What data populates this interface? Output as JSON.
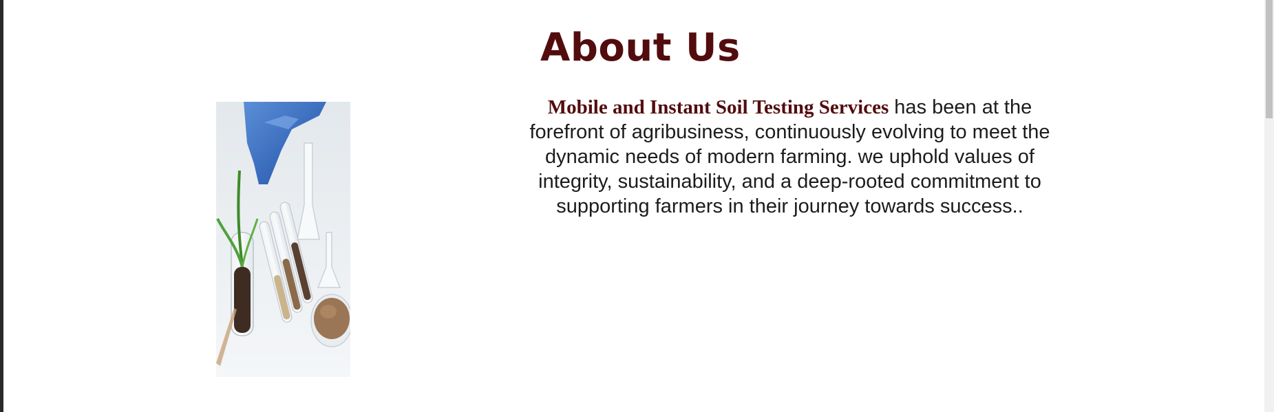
{
  "about": {
    "title": "About Us",
    "company_name": "Mobile and Instant Soil Testing Services",
    "description": " has been at the forefront of agribusiness, continuously evolving to meet the dynamic needs of modern farming. we uphold values of integrity, sustainability, and a deep-rooted commitment to supporting farmers in their journey towards success..",
    "colors": {
      "heading": "#530c0e",
      "body_text": "#1c1c1c",
      "background": "#ffffff"
    }
  },
  "image": {
    "subject": "soil-testing-lab-photo"
  }
}
